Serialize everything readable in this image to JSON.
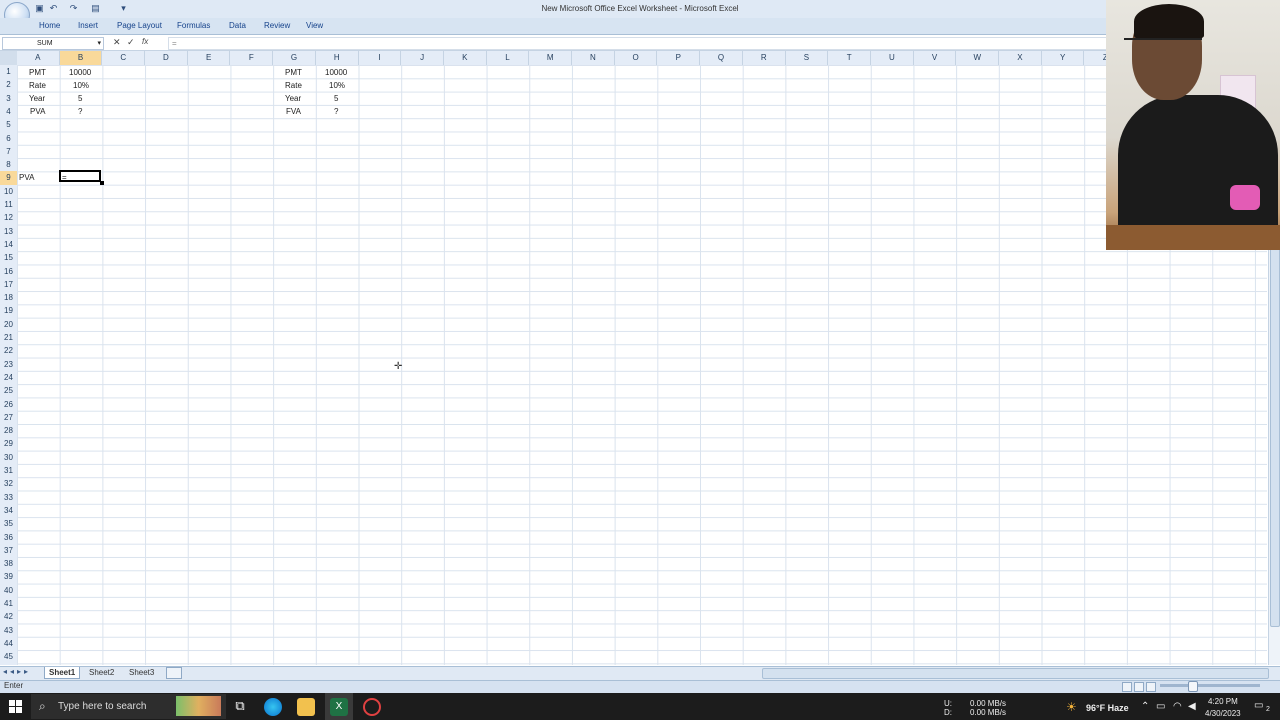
{
  "window": {
    "title": "New Microsoft Office Excel Worksheet - Microsoft Excel"
  },
  "ribbon": {
    "tabs": [
      "Home",
      "Insert",
      "Page Layout",
      "Formulas",
      "Data",
      "Review",
      "View"
    ]
  },
  "formula_bar": {
    "name_box": "SUM",
    "formula": "="
  },
  "grid": {
    "columns": [
      "A",
      "B",
      "C",
      "D",
      "E",
      "F",
      "G",
      "H",
      "I",
      "J",
      "K",
      "L",
      "M",
      "N",
      "O",
      "P",
      "Q",
      "R",
      "S",
      "T",
      "U",
      "V",
      "W",
      "X",
      "Y",
      "Z"
    ],
    "selected_column": "B",
    "selected_row": 9,
    "rows_visible": 45,
    "cells": {
      "A1": "PMT",
      "B1": "10000",
      "A2": "Rate",
      "B2": "10%",
      "A3": "Year",
      "B3": "5",
      "A4": "PVA",
      "B4": "?",
      "G1": "PMT",
      "H1": "10000",
      "G2": "Rate",
      "H2": "10%",
      "G3": "Year",
      "H3": "5",
      "G4": "FVA",
      "H4": "?",
      "A9": "PVA",
      "B9": "="
    }
  },
  "sheets": {
    "tabs": [
      "Sheet1",
      "Sheet2",
      "Sheet3"
    ],
    "active": "Sheet1"
  },
  "status": {
    "mode": "Enter"
  },
  "taskbar": {
    "search_placeholder": "Type here to search",
    "network_up_label": "U:",
    "network_up": "0.00 MB/s",
    "network_down_label": "D:",
    "network_down": "0.00 MB/s",
    "weather": "96°F Haze",
    "time": "4:20 PM",
    "date": "4/30/2023",
    "notifications": "2"
  },
  "colors": {
    "ribbon_bg": "#d7e4f2",
    "header_selected": "#f9d99a",
    "taskbar_bg": "#1c1c1c"
  }
}
